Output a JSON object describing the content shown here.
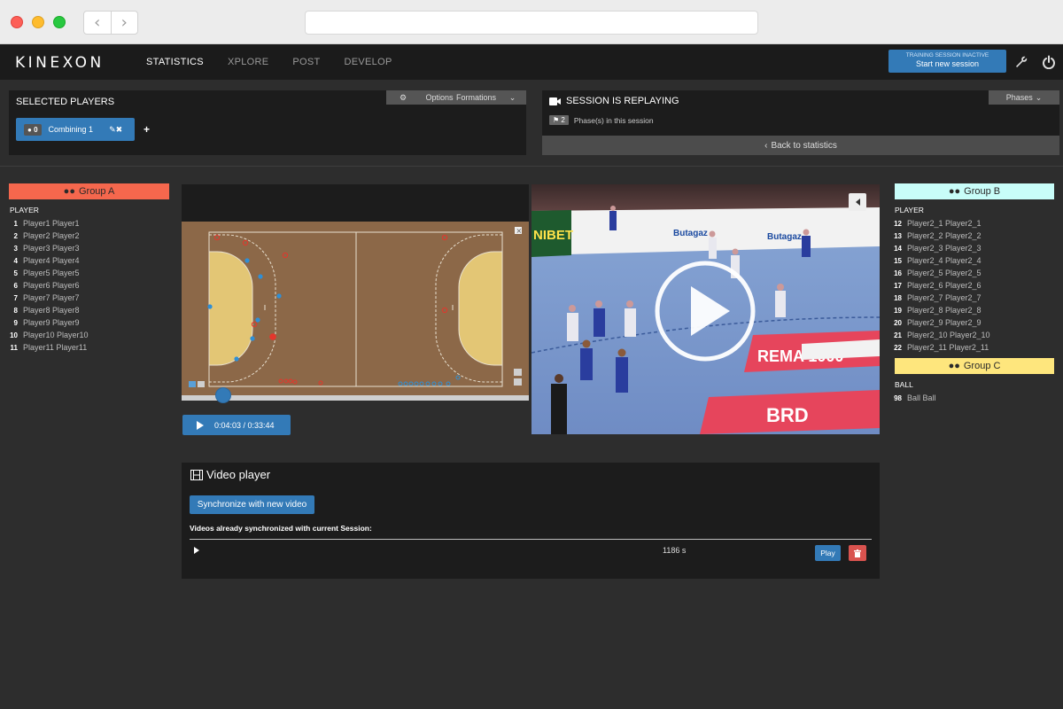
{
  "nav": {
    "logo": "KINEXON",
    "links": [
      "STATISTICS",
      "XPLORE",
      "POST",
      "DEVELOP"
    ],
    "active_link": "STATISTICS",
    "session_status": "TRAINING SESSION INACTIVE",
    "session_button": "Start new session",
    "icons": [
      "wrench-icon",
      "power-icon"
    ]
  },
  "selected_players": {
    "title": "SELECTED PLAYERS",
    "options_label": "Options",
    "formations_label": "Formations",
    "combine_count": "0",
    "combine_label": "Combining 1",
    "add_symbol": "+"
  },
  "session": {
    "title": "SESSION IS REPLAYING",
    "phases_label": "Phases",
    "phase_count": "2",
    "phase_text": "Phase(s) in this session",
    "back_label": "Back to statistics"
  },
  "group_a": {
    "name": "Group A",
    "color": "#f5674d",
    "list_title": "PLAYER",
    "players": [
      {
        "num": "1",
        "name": "Player1 Player1"
      },
      {
        "num": "2",
        "name": "Player2 Player2"
      },
      {
        "num": "3",
        "name": "Player3 Player3"
      },
      {
        "num": "4",
        "name": "Player4 Player4"
      },
      {
        "num": "5",
        "name": "Player5 Player5"
      },
      {
        "num": "6",
        "name": "Player6 Player6"
      },
      {
        "num": "7",
        "name": "Player7 Player7"
      },
      {
        "num": "8",
        "name": "Player8 Player8"
      },
      {
        "num": "9",
        "name": "Player9 Player9"
      },
      {
        "num": "10",
        "name": "Player10 Player10"
      },
      {
        "num": "11",
        "name": "Player11 Player11"
      }
    ]
  },
  "group_b": {
    "name": "Group B",
    "color": "#c8fdf9",
    "list_title": "PLAYER",
    "players": [
      {
        "num": "12",
        "name": "Player2_1 Player2_1"
      },
      {
        "num": "13",
        "name": "Player2_2 Player2_2"
      },
      {
        "num": "14",
        "name": "Player2_3 Player2_3"
      },
      {
        "num": "15",
        "name": "Player2_4 Player2_4"
      },
      {
        "num": "16",
        "name": "Player2_5 Player2_5"
      },
      {
        "num": "17",
        "name": "Player2_6 Player2_6"
      },
      {
        "num": "18",
        "name": "Player2_7 Player2_7"
      },
      {
        "num": "19",
        "name": "Player2_8 Player2_8"
      },
      {
        "num": "20",
        "name": "Player2_9 Player2_9"
      },
      {
        "num": "21",
        "name": "Player2_10 Player2_10"
      },
      {
        "num": "22",
        "name": "Player2_11 Player2_11"
      }
    ]
  },
  "group_c": {
    "name": "Group C",
    "color": "#fee67d",
    "list_title": "BALL",
    "players": [
      {
        "num": "98",
        "name": "Ball Ball"
      }
    ]
  },
  "playback": {
    "time": "0:04:03 / 0:33:44",
    "progress": 0.12
  },
  "video_player": {
    "title": "Video player",
    "sync_button": "Synchronize with new video",
    "subtitle": "Videos already synchronized with current Session:",
    "videos": [
      {
        "duration": "1186 s",
        "play_label": "Play"
      }
    ]
  },
  "video_ads": {
    "sponsor1": "Butagaz",
    "sponsor2": "Butagaz",
    "sponsor3": "NIBET",
    "floor1": "REMA 1000",
    "floor2": "BRD"
  },
  "colors": {
    "accent": "#337ab7",
    "danger": "#d9534f",
    "pitch": "#8c6848",
    "goal_area": "#e3c675",
    "team_red": "#e4362c",
    "team_blue": "#2f8fd6"
  }
}
